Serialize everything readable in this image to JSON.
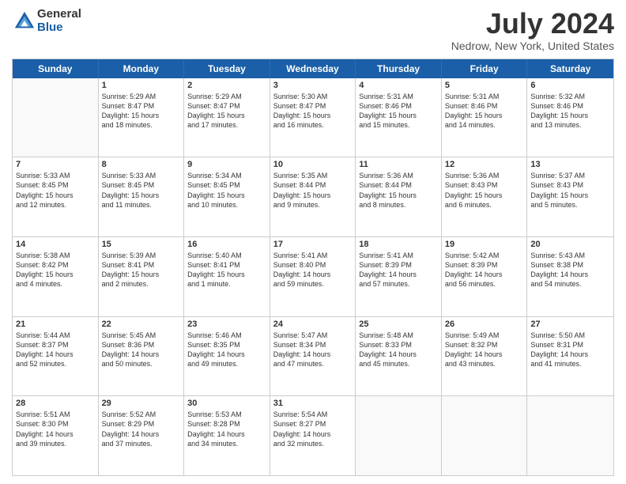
{
  "logo": {
    "general": "General",
    "blue": "Blue"
  },
  "title": "July 2024",
  "subtitle": "Nedrow, New York, United States",
  "headers": [
    "Sunday",
    "Monday",
    "Tuesday",
    "Wednesday",
    "Thursday",
    "Friday",
    "Saturday"
  ],
  "weeks": [
    [
      {
        "day": "",
        "info": ""
      },
      {
        "day": "1",
        "info": "Sunrise: 5:29 AM\nSunset: 8:47 PM\nDaylight: 15 hours\nand 18 minutes."
      },
      {
        "day": "2",
        "info": "Sunrise: 5:29 AM\nSunset: 8:47 PM\nDaylight: 15 hours\nand 17 minutes."
      },
      {
        "day": "3",
        "info": "Sunrise: 5:30 AM\nSunset: 8:47 PM\nDaylight: 15 hours\nand 16 minutes."
      },
      {
        "day": "4",
        "info": "Sunrise: 5:31 AM\nSunset: 8:46 PM\nDaylight: 15 hours\nand 15 minutes."
      },
      {
        "day": "5",
        "info": "Sunrise: 5:31 AM\nSunset: 8:46 PM\nDaylight: 15 hours\nand 14 minutes."
      },
      {
        "day": "6",
        "info": "Sunrise: 5:32 AM\nSunset: 8:46 PM\nDaylight: 15 hours\nand 13 minutes."
      }
    ],
    [
      {
        "day": "7",
        "info": "Sunrise: 5:33 AM\nSunset: 8:45 PM\nDaylight: 15 hours\nand 12 minutes."
      },
      {
        "day": "8",
        "info": "Sunrise: 5:33 AM\nSunset: 8:45 PM\nDaylight: 15 hours\nand 11 minutes."
      },
      {
        "day": "9",
        "info": "Sunrise: 5:34 AM\nSunset: 8:45 PM\nDaylight: 15 hours\nand 10 minutes."
      },
      {
        "day": "10",
        "info": "Sunrise: 5:35 AM\nSunset: 8:44 PM\nDaylight: 15 hours\nand 9 minutes."
      },
      {
        "day": "11",
        "info": "Sunrise: 5:36 AM\nSunset: 8:44 PM\nDaylight: 15 hours\nand 8 minutes."
      },
      {
        "day": "12",
        "info": "Sunrise: 5:36 AM\nSunset: 8:43 PM\nDaylight: 15 hours\nand 6 minutes."
      },
      {
        "day": "13",
        "info": "Sunrise: 5:37 AM\nSunset: 8:43 PM\nDaylight: 15 hours\nand 5 minutes."
      }
    ],
    [
      {
        "day": "14",
        "info": "Sunrise: 5:38 AM\nSunset: 8:42 PM\nDaylight: 15 hours\nand 4 minutes."
      },
      {
        "day": "15",
        "info": "Sunrise: 5:39 AM\nSunset: 8:41 PM\nDaylight: 15 hours\nand 2 minutes."
      },
      {
        "day": "16",
        "info": "Sunrise: 5:40 AM\nSunset: 8:41 PM\nDaylight: 15 hours\nand 1 minute."
      },
      {
        "day": "17",
        "info": "Sunrise: 5:41 AM\nSunset: 8:40 PM\nDaylight: 14 hours\nand 59 minutes."
      },
      {
        "day": "18",
        "info": "Sunrise: 5:41 AM\nSunset: 8:39 PM\nDaylight: 14 hours\nand 57 minutes."
      },
      {
        "day": "19",
        "info": "Sunrise: 5:42 AM\nSunset: 8:39 PM\nDaylight: 14 hours\nand 56 minutes."
      },
      {
        "day": "20",
        "info": "Sunrise: 5:43 AM\nSunset: 8:38 PM\nDaylight: 14 hours\nand 54 minutes."
      }
    ],
    [
      {
        "day": "21",
        "info": "Sunrise: 5:44 AM\nSunset: 8:37 PM\nDaylight: 14 hours\nand 52 minutes."
      },
      {
        "day": "22",
        "info": "Sunrise: 5:45 AM\nSunset: 8:36 PM\nDaylight: 14 hours\nand 50 minutes."
      },
      {
        "day": "23",
        "info": "Sunrise: 5:46 AM\nSunset: 8:35 PM\nDaylight: 14 hours\nand 49 minutes."
      },
      {
        "day": "24",
        "info": "Sunrise: 5:47 AM\nSunset: 8:34 PM\nDaylight: 14 hours\nand 47 minutes."
      },
      {
        "day": "25",
        "info": "Sunrise: 5:48 AM\nSunset: 8:33 PM\nDaylight: 14 hours\nand 45 minutes."
      },
      {
        "day": "26",
        "info": "Sunrise: 5:49 AM\nSunset: 8:32 PM\nDaylight: 14 hours\nand 43 minutes."
      },
      {
        "day": "27",
        "info": "Sunrise: 5:50 AM\nSunset: 8:31 PM\nDaylight: 14 hours\nand 41 minutes."
      }
    ],
    [
      {
        "day": "28",
        "info": "Sunrise: 5:51 AM\nSunset: 8:30 PM\nDaylight: 14 hours\nand 39 minutes."
      },
      {
        "day": "29",
        "info": "Sunrise: 5:52 AM\nSunset: 8:29 PM\nDaylight: 14 hours\nand 37 minutes."
      },
      {
        "day": "30",
        "info": "Sunrise: 5:53 AM\nSunset: 8:28 PM\nDaylight: 14 hours\nand 34 minutes."
      },
      {
        "day": "31",
        "info": "Sunrise: 5:54 AM\nSunset: 8:27 PM\nDaylight: 14 hours\nand 32 minutes."
      },
      {
        "day": "",
        "info": ""
      },
      {
        "day": "",
        "info": ""
      },
      {
        "day": "",
        "info": ""
      }
    ]
  ]
}
